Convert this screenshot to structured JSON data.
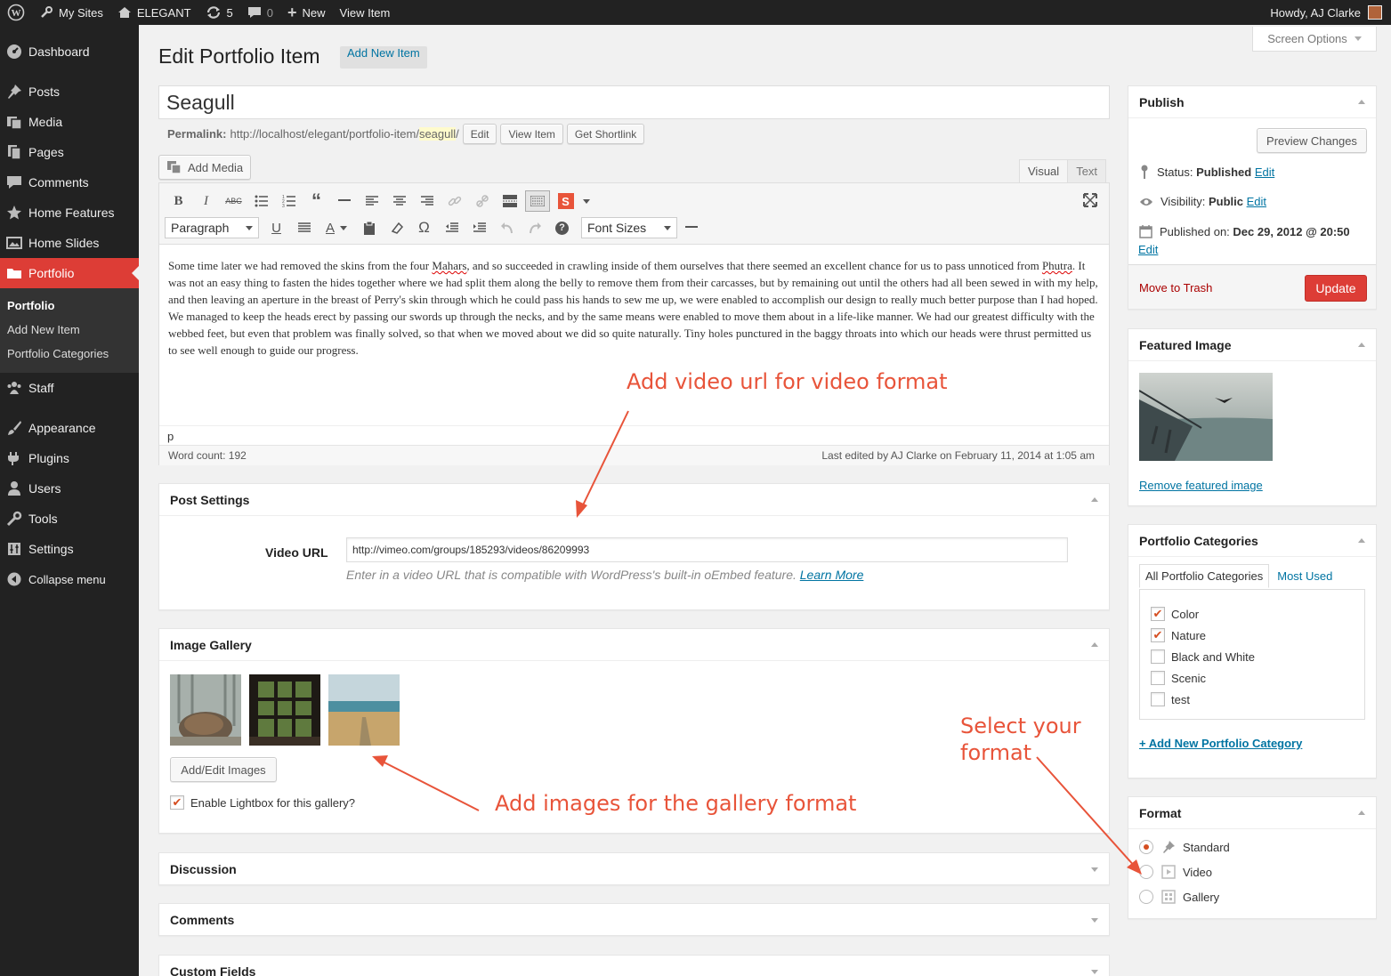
{
  "admin_bar": {
    "my_sites": "My Sites",
    "site_name": "ELEGANT",
    "updates_count": "5",
    "comments_count": "0",
    "new_label": "New",
    "view_item": "View Item",
    "howdy": "Howdy, AJ Clarke"
  },
  "sidebar": {
    "items": [
      {
        "label": "Dashboard",
        "icon": "dashboard-icon"
      },
      {
        "label": "Posts",
        "icon": "pin-icon"
      },
      {
        "label": "Media",
        "icon": "media-icon"
      },
      {
        "label": "Pages",
        "icon": "pages-icon"
      },
      {
        "label": "Comments",
        "icon": "comment-icon"
      },
      {
        "label": "Home Features",
        "icon": "star-icon"
      },
      {
        "label": "Home Slides",
        "icon": "slides-icon"
      },
      {
        "label": "Portfolio",
        "icon": "folder-icon"
      },
      {
        "label": "Staff",
        "icon": "group-icon"
      },
      {
        "label": "Appearance",
        "icon": "brush-icon"
      },
      {
        "label": "Plugins",
        "icon": "plugin-icon"
      },
      {
        "label": "Users",
        "icon": "user-icon"
      },
      {
        "label": "Tools",
        "icon": "wrench-icon"
      },
      {
        "label": "Settings",
        "icon": "settings-icon"
      }
    ],
    "submenu": [
      "Portfolio",
      "Add New Item",
      "Portfolio Categories"
    ],
    "collapse": "Collapse menu"
  },
  "header": {
    "title": "Edit Portfolio Item",
    "add_new": "Add New Item",
    "screen_options": "Screen Options"
  },
  "post": {
    "title": "Seagull",
    "permalink_label": "Permalink:",
    "permalink_base": "http://localhost/elegant/portfolio-item/",
    "permalink_slug": "seagull",
    "permalink_tail": "/",
    "edit_btn": "Edit",
    "view_btn": "View Item",
    "shortlink_btn": "Get Shortlink"
  },
  "editor": {
    "add_media": "Add Media",
    "tab_visual": "Visual",
    "tab_text": "Text",
    "format_select": "Paragraph",
    "font_sizes": "Font Sizes",
    "content": {
      "t1": "Some time later we had removed the skins from the four ",
      "w1": "Mahars",
      "t2": ", and so succeeded in crawling inside of them ourselves that there seemed an excellent chance for us to pass unnoticed from ",
      "w2": "Phutra",
      "t3": ". It was not an easy thing to fasten the hides together where we had split them along the belly to remove them from their carcasses, but by remaining out until the others had all been sewed in with my help, and then leaving an aperture in the breast of Perry's skin through which he could pass his hands to sew me up, we were enabled to accomplish our design to really much better purpose than I had hoped. We managed to keep the heads erect by passing our swords up through the necks, and by the same means were enabled to move them about in a life-like manner. We had our greatest difficulty with the webbed feet, but even that problem was finally solved, so that when we moved about we did so quite naturally. Tiny holes punctured in the baggy throats into which our heads were thrust permitted us to see well enough to guide our progress."
    },
    "path": "p",
    "word_count": "Word count: 192",
    "last_edited": "Last edited by AJ Clarke on February 11, 2014 at 1:05 am"
  },
  "post_settings": {
    "title": "Post Settings",
    "video_label": "Video URL",
    "video_value": "http://vimeo.com/groups/185293/videos/86209993",
    "help": "Enter in a video URL that is compatible with WordPress's built-in oEmbed feature.",
    "learn_more": "Learn More"
  },
  "gallery": {
    "title": "Image Gallery",
    "button": "Add/Edit Images",
    "lightbox_label": "Enable Lightbox for this gallery?",
    "lightbox_checked": true
  },
  "discussion": {
    "title": "Discussion"
  },
  "comments_box": {
    "title": "Comments"
  },
  "custom_fields": {
    "title": "Custom Fields"
  },
  "publish": {
    "title": "Publish",
    "preview": "Preview Changes",
    "status_label": "Status:",
    "status_value": "Published",
    "visibility_label": "Visibility:",
    "visibility_value": "Public",
    "published_label": "Published on:",
    "published_value": "Dec 29, 2012 @ 20:50",
    "edit": "Edit",
    "trash": "Move to Trash",
    "update": "Update"
  },
  "featured": {
    "title": "Featured Image",
    "remove": "Remove featured image"
  },
  "categories": {
    "title": "Portfolio Categories",
    "tab_all": "All Portfolio Categories",
    "tab_used": "Most Used",
    "items": [
      {
        "label": "Color",
        "checked": true
      },
      {
        "label": "Nature",
        "checked": true
      },
      {
        "label": "Black and White",
        "checked": false
      },
      {
        "label": "Scenic",
        "checked": false
      },
      {
        "label": "test",
        "checked": false
      }
    ],
    "add_new": "+ Add New Portfolio Category"
  },
  "format": {
    "title": "Format",
    "options": [
      {
        "label": "Standard",
        "selected": true
      },
      {
        "label": "Video",
        "selected": false
      },
      {
        "label": "Gallery",
        "selected": false
      }
    ]
  },
  "annotations": {
    "video": "Add video url for video format",
    "gallery": "Add images for the gallery format",
    "format_line1": "Select your",
    "format_line2": "format"
  },
  "colors": {
    "accent_red": "#dd3d36",
    "link_blue": "#0074a2",
    "annotation": "#e8543a",
    "sidebar_bg": "#222222"
  }
}
